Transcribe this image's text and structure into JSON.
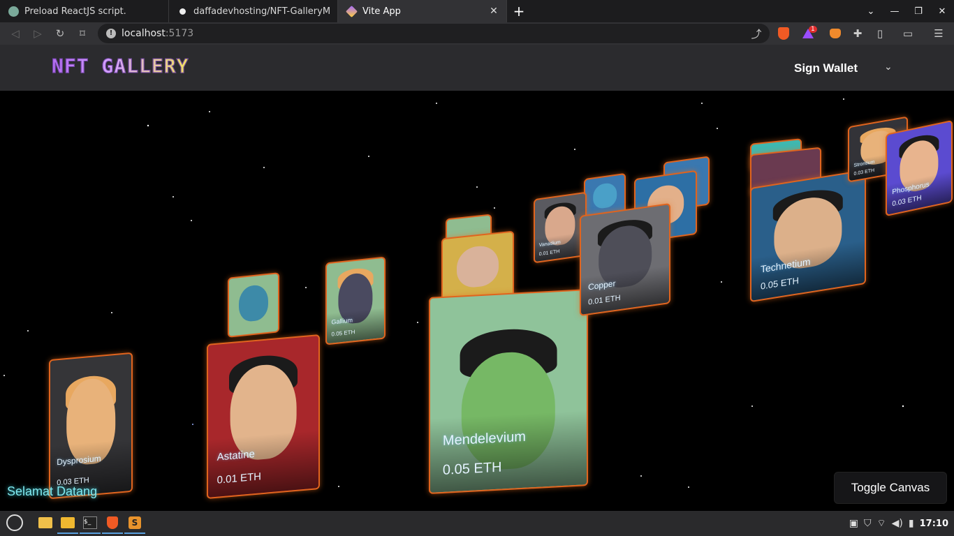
{
  "browser": {
    "tabs": [
      {
        "title": "Preload ReactJS script.",
        "icon": "chatgpt-icon",
        "active": false
      },
      {
        "title": "daffadevhosting/NFT-GalleryMark",
        "icon": "github-icon",
        "active": false
      },
      {
        "title": "Vite App",
        "icon": "vite-icon",
        "active": true
      }
    ],
    "address": {
      "host": "localhost",
      "port": ":5173"
    },
    "brave_badge": "1"
  },
  "app": {
    "logo": "NFT GALLERY",
    "sign_wallet": "Sign Wallet",
    "welcome": "Selamat Datang",
    "toggle_canvas": "Toggle Canvas",
    "accent_color": "#e0641e",
    "welcome_color": "#7fe8ef"
  },
  "nfts": [
    {
      "name": "Dysprosium",
      "price": "0.03 ETH",
      "bg": "#3a3a3a",
      "skin": "#e8b27a"
    },
    {
      "name": "Astatine",
      "price": "0.01 ETH",
      "bg": "#a8272b",
      "skin": "#e2b48c"
    },
    {
      "name": "Mendelevium",
      "price": "0.05 ETH",
      "bg": "#8fc39a",
      "skin": "#76b865"
    },
    {
      "name": "Gallium",
      "price": "0.05 ETH",
      "bg": "#8fbc90",
      "skin": "#4a4a60"
    },
    {
      "name": "Copper",
      "price": "0.01 ETH",
      "bg": "#6d6d72",
      "skin": "#4e4e58"
    },
    {
      "name": "Vanadium",
      "price": "0.01 ETH",
      "bg": "#5a5a60",
      "skin": "#d9a88c"
    },
    {
      "name": "Technetium",
      "price": "0.05 ETH",
      "bg": "#2a5f8a",
      "skin": "#dcb08a"
    },
    {
      "name": "Strontium",
      "price": "0.03 ETH",
      "bg": "#333338",
      "skin": "#e8b27a"
    },
    {
      "name": "Phosphorus",
      "price": "0.03 ETH",
      "bg": "#5b4bd0",
      "skin": "#e8b48e"
    }
  ],
  "taskbar": {
    "clock": "17:10"
  }
}
